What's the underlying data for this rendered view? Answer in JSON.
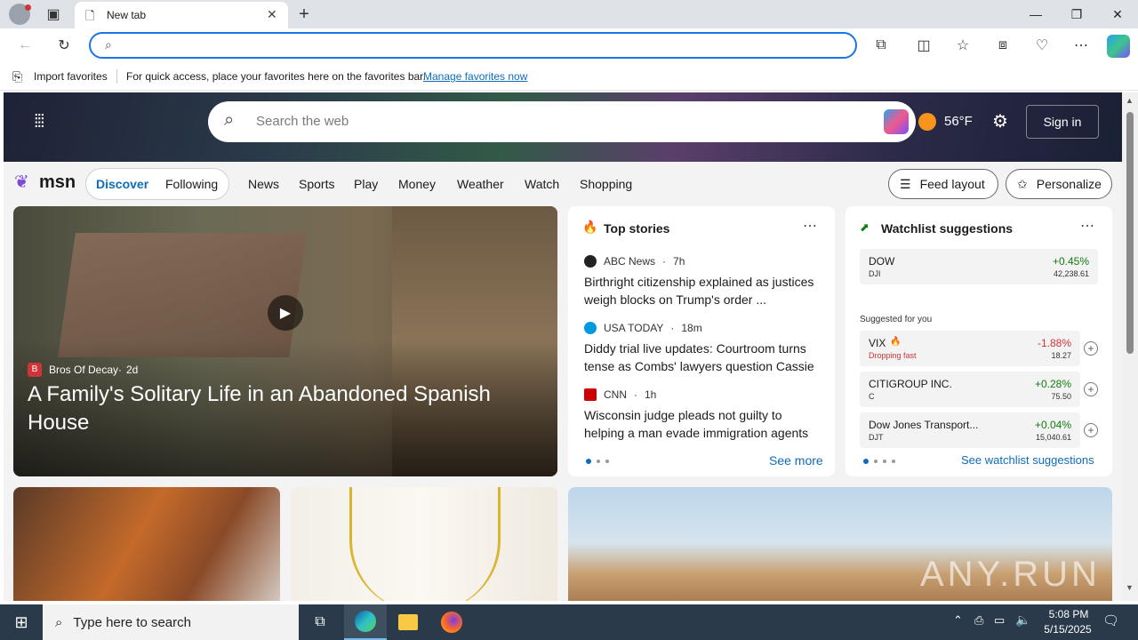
{
  "browser": {
    "tab_title": "New tab",
    "address_value": "",
    "favbar_import": "Import favorites",
    "favbar_hint": "For quick access, place your favorites here on the favorites bar.",
    "favbar_manage": "Manage favorites now"
  },
  "msn": {
    "search_placeholder": "Search the web",
    "weather_temp": "56°F",
    "signin": "Sign in",
    "logo": "msn",
    "tabs": [
      "Discover",
      "Following"
    ],
    "nav": [
      "News",
      "Sports",
      "Play",
      "Money",
      "Weather",
      "Watch",
      "Shopping"
    ],
    "feed_layout": "Feed layout",
    "personalize": "Personalize"
  },
  "feature": {
    "source": "Bros Of Decay",
    "age": "2d",
    "headline": "A Family's Solitary Life in an Abandoned Spanish House"
  },
  "top_stories": {
    "title": "Top stories",
    "items": [
      {
        "source": "ABC News",
        "age": "7h",
        "headline": "Birthright citizenship explained as justices weigh blocks on Trump's order ..."
      },
      {
        "source": "USA TODAY",
        "age": "18m",
        "headline": "Diddy trial live updates: Courtroom turns tense as Combs' lawyers question Cassie"
      },
      {
        "source": "CNN",
        "age": "1h",
        "headline": "Wisconsin judge pleads not guilty to helping a man evade immigration agents"
      }
    ],
    "see_more": "See more"
  },
  "watchlist": {
    "title": "Watchlist suggestions",
    "main": {
      "name": "DOW",
      "ticker": "DJI",
      "change": "+0.45%",
      "price": "42,238.61"
    },
    "suggested_label": "Suggested for you",
    "suggested": [
      {
        "name": "VIX",
        "ticker": "Dropping fast",
        "change": "-1.88%",
        "price": "18.27"
      },
      {
        "name": "CITIGROUP INC.",
        "ticker": "C",
        "change": "+0.28%",
        "price": "75.50"
      },
      {
        "name": "Dow Jones Transport...",
        "ticker": "DJT",
        "change": "+0.04%",
        "price": "15,040.61"
      }
    ],
    "see_link": "See watchlist suggestions"
  },
  "watermark": "ANY.RUN",
  "taskbar": {
    "search_placeholder": "Type here to search",
    "time": "5:08 PM",
    "date": "5/15/2025"
  },
  "colors": {
    "accent": "#0f6cbd",
    "positive": "#107c10",
    "negative": "#d13438"
  }
}
